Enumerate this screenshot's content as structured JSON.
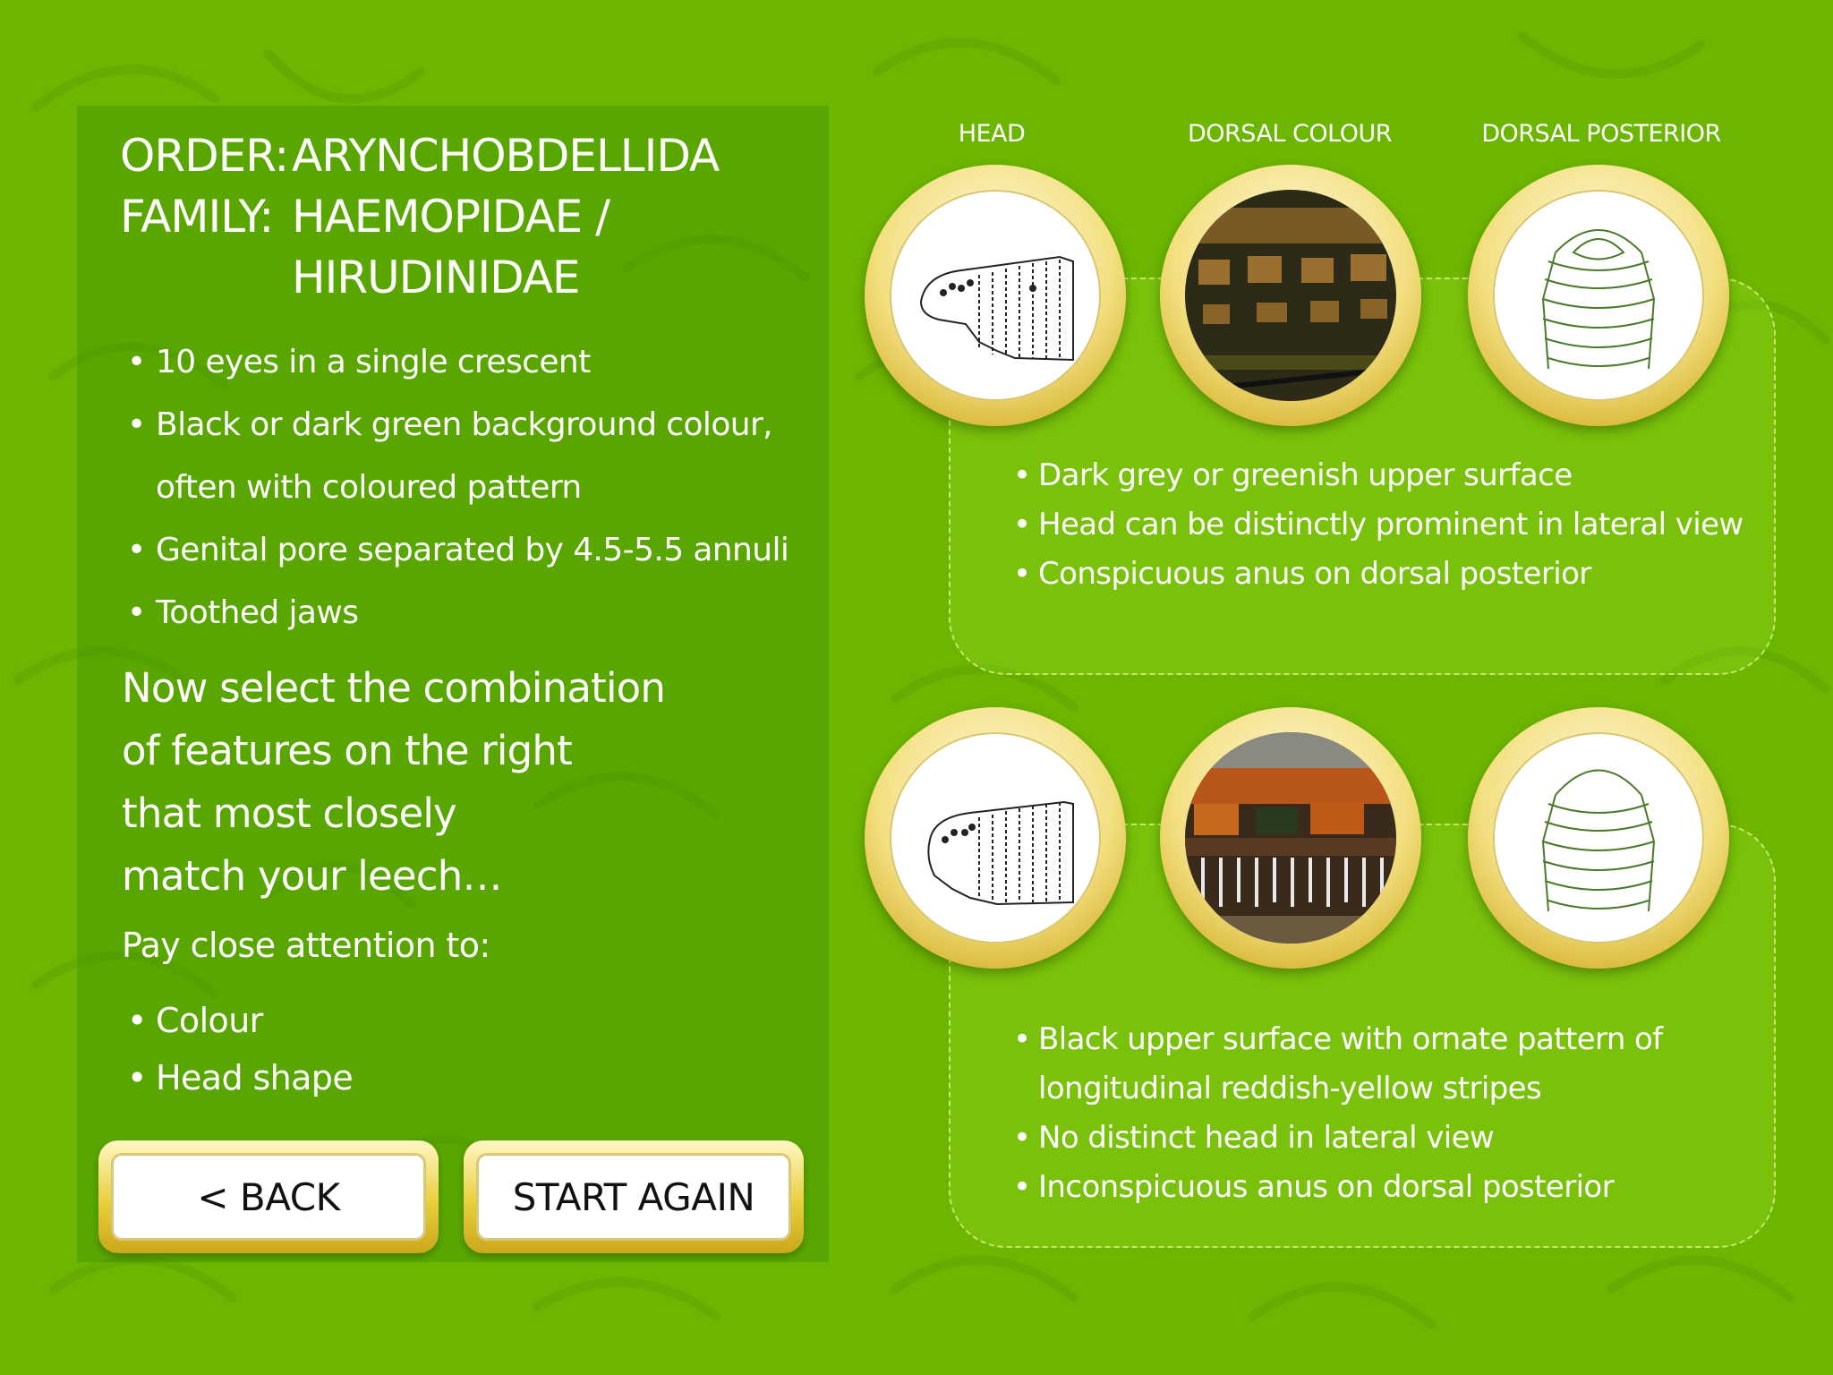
{
  "order": {
    "label": "ORDER:",
    "value": "ARYNCHOBDELLIDA"
  },
  "family": {
    "label": "FAMILY:",
    "value_line1": "HAEMOPIDAE /",
    "value_line2": "HIRUDINIDAE"
  },
  "features": [
    "10 eyes in a single crescent",
    "Black or dark green background colour,",
    "often with coloured pattern",
    "Genital pore separated by 4.5-5.5 annuli",
    "Toothed jaws"
  ],
  "instruction": {
    "line1": "Now select the combination",
    "line2": "of features on the right",
    "line3": "that most closely",
    "line4": "match your leech…"
  },
  "attention": {
    "heading": "Pay close attention to:",
    "items": [
      "Colour",
      "Head shape"
    ]
  },
  "buttons": {
    "back": "< BACK",
    "start_again": "START AGAIN"
  },
  "columns": {
    "head": "HEAD",
    "dorsal_colour": "DORSAL COLOUR",
    "dorsal_posterior": "DORSAL POSTERIOR"
  },
  "option1": {
    "bullets": [
      "Dark grey or greenish upper surface",
      "Head can be distinctly prominent in lateral view",
      "Conspicuous anus on dorsal posterior"
    ]
  },
  "option2": {
    "bullets": [
      "Black upper surface with ornate pattern of",
      "longitudinal reddish-yellow stripes",
      "No distinct head in lateral view",
      "Inconspicuous anus on dorsal posterior"
    ]
  },
  "colors": {
    "background": "#6cb500",
    "gold": "#e9cf3c",
    "text": "#ffffff"
  }
}
